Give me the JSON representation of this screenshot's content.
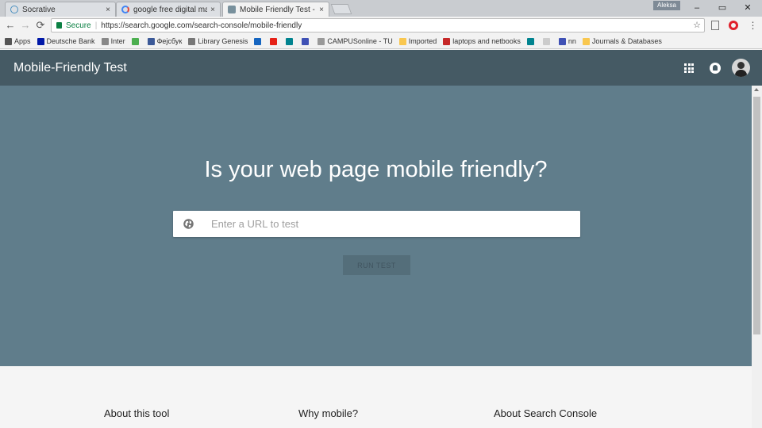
{
  "tabs": [
    {
      "title": "Socrative"
    },
    {
      "title": "google free digital marke"
    },
    {
      "title": "Mobile Friendly Test - Go"
    }
  ],
  "tab_close_glyph": "×",
  "profile_chip": "Aleksa",
  "window_controls": {
    "minimize": "–",
    "restore": "▭",
    "close": "✕"
  },
  "toolbar": {
    "back": "←",
    "forward": "→",
    "reload": "⟳"
  },
  "omnibox": {
    "secure_label": "Secure",
    "separator": "|",
    "url": "https://search.google.com/search-console/mobile-friendly",
    "star": "☆"
  },
  "bookmarks": [
    {
      "label": "Apps",
      "color": "#555555"
    },
    {
      "label": "Deutsche Bank",
      "color": "#0018a8"
    },
    {
      "label": "Inter",
      "color": "#888888"
    },
    {
      "label": "",
      "color": "#4caf50"
    },
    {
      "label": "Фејсбук",
      "color": "#3b5998"
    },
    {
      "label": "Library Genesis",
      "color": "#777777"
    },
    {
      "label": "",
      "color": "#1565c0"
    },
    {
      "label": "",
      "color": "#e62117"
    },
    {
      "label": "",
      "color": "#00838f"
    },
    {
      "label": "",
      "color": "#3f51b5"
    },
    {
      "label": "CAMPUSonline - TU",
      "color": "#999999"
    },
    {
      "label": "Imported",
      "color": "#f9c74f"
    },
    {
      "label": "laptops and netbooks",
      "color": "#c62828"
    },
    {
      "label": "",
      "color": "#00838f"
    },
    {
      "label": "",
      "color": "#cccccc"
    },
    {
      "label": "nn",
      "color": "#3f51b5"
    },
    {
      "label": "Journals & Databases",
      "color": "#f9c74f"
    }
  ],
  "app_bar": {
    "title": "Mobile-Friendly Test"
  },
  "hero": {
    "heading": "Is your web page mobile friendly?",
    "url_placeholder": "Enter a URL to test",
    "run_button": "RUN TEST"
  },
  "info_sections": [
    {
      "heading": "About this tool"
    },
    {
      "heading": "Why mobile?"
    },
    {
      "heading": "About Search Console"
    }
  ],
  "colors": {
    "app_bar": "#455a64",
    "hero": "#607d8b",
    "run_button": "#546e7a",
    "secure": "#0b8043"
  }
}
